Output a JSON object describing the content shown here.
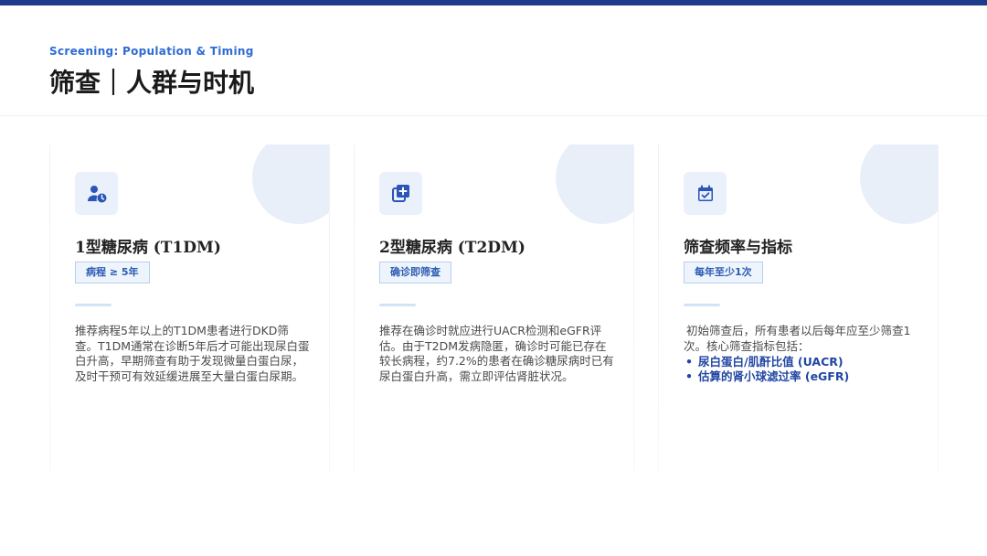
{
  "header": {
    "subtitle": "Screening: Population & Timing",
    "title": "筛查｜人群与时机"
  },
  "cards": [
    {
      "icon": "user-clock-icon",
      "title": "1型糖尿病 (T1DM)",
      "badge": "病程 ≥ 5年",
      "desc": "推荐病程5年以上的T1DM患者进行DKD筛查。T1DM通常在诊断5年后才可能出现尿白蛋白升高，早期筛查有助于发现微量白蛋白尿，及时干预可有效延缓进展至大量白蛋白尿期。"
    },
    {
      "icon": "add-box-icon",
      "title": "2型糖尿病 (T2DM)",
      "badge": "确诊即筛查",
      "desc": "推荐在确诊时就应进行UACR检测和eGFR评估。由于T2DM发病隐匿，确诊时可能已存在较长病程，约7.2%的患者在确诊糖尿病时已有尿白蛋白升高，需立即评估肾脏状况。"
    },
    {
      "icon": "calendar-check-icon",
      "title": "筛查频率与指标",
      "badge": "每年至少1次",
      "desc": "初始筛查后，所有患者以后每年应至少筛查1次。核心筛查指标包括：",
      "bullets": [
        "尿白蛋白/肌酐比值 (UACR)",
        "估算的肾小球滤过率 (eGFR)"
      ]
    }
  ],
  "colors": {
    "accent": "#2f6bd3",
    "top_bar": "#1e3a8a",
    "bullet_text": "#2046a3"
  }
}
